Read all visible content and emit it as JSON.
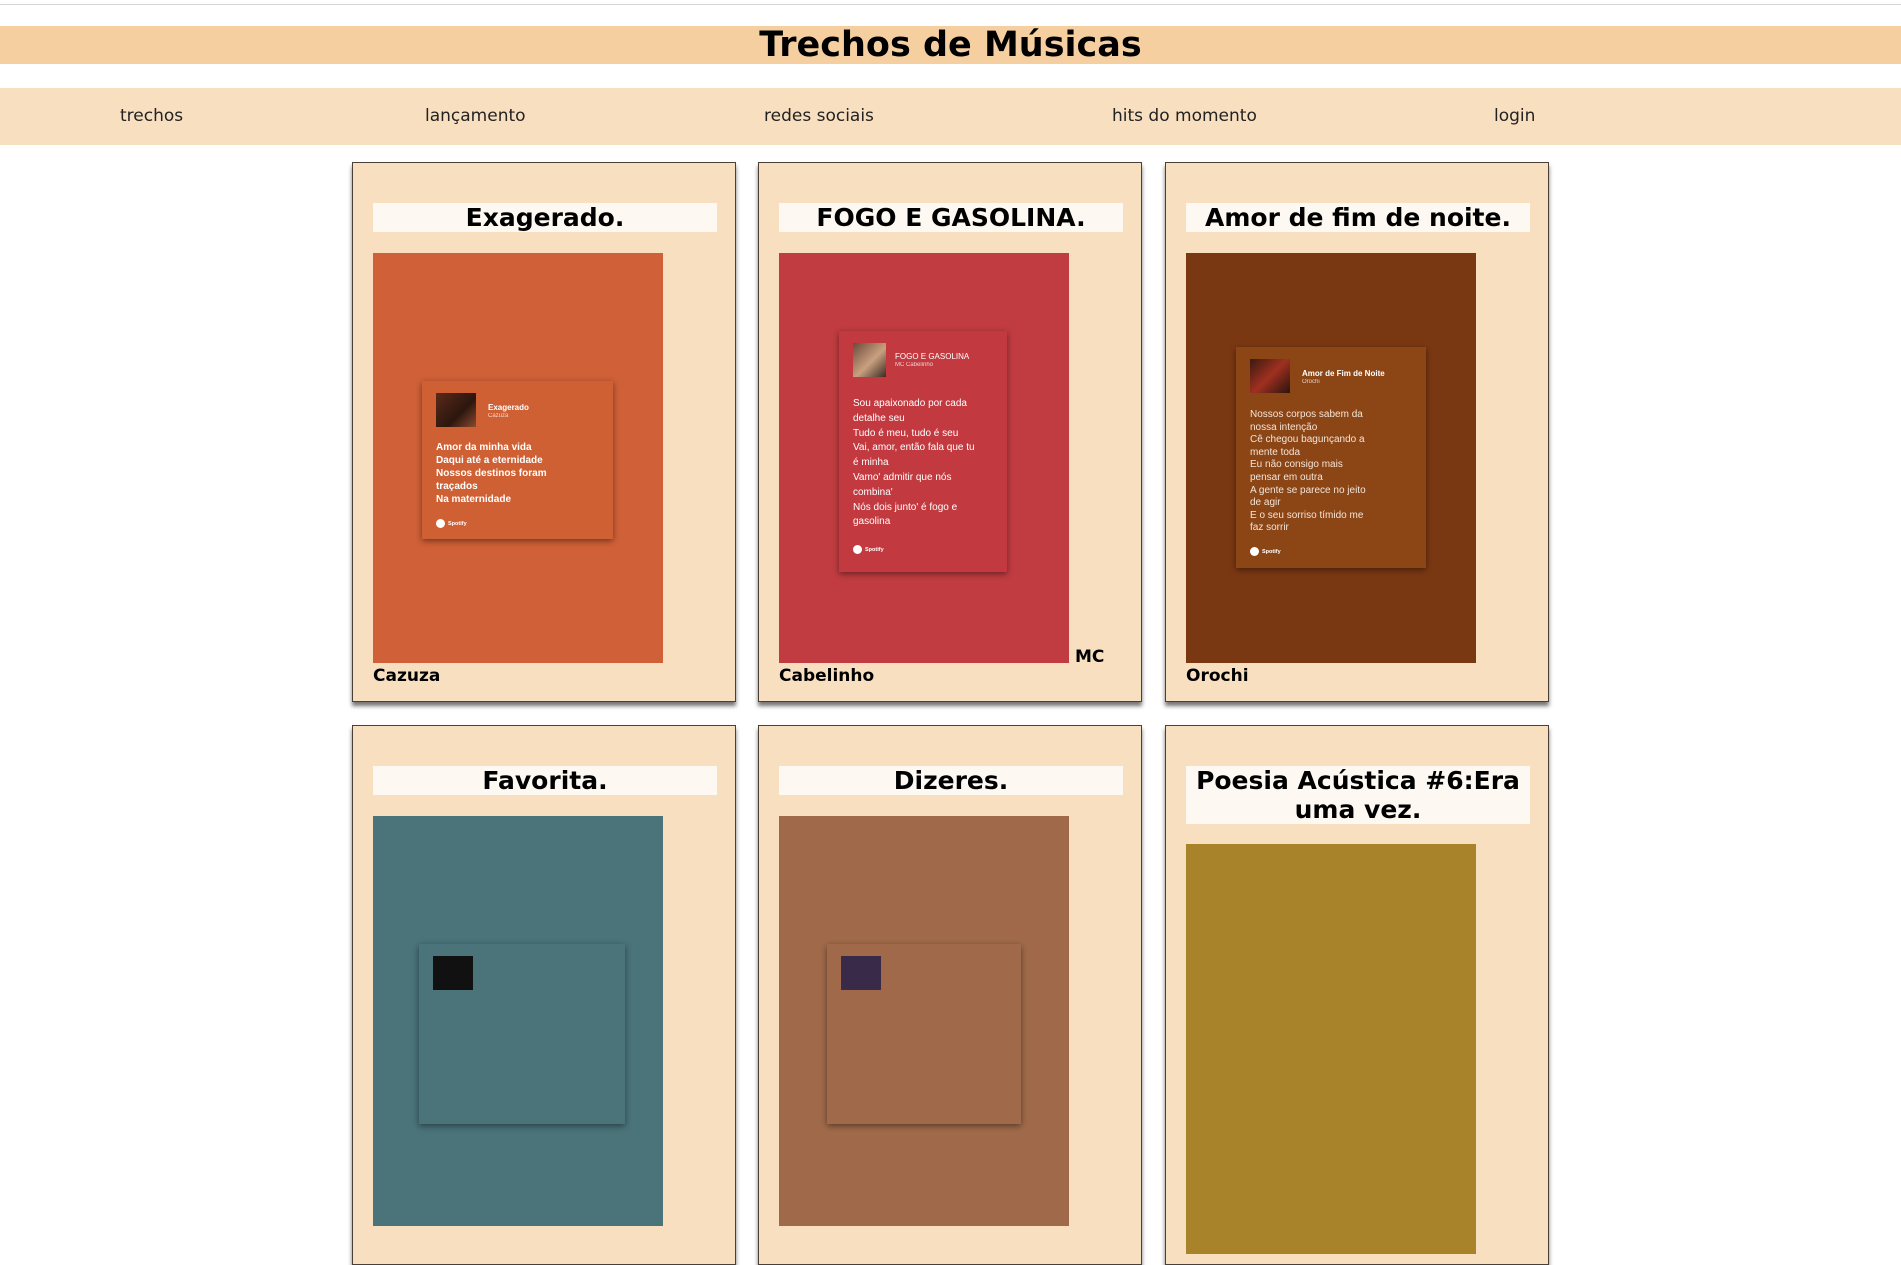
{
  "header": {
    "title": "Trechos de Músicas"
  },
  "nav": {
    "items": [
      {
        "label": "trechos"
      },
      {
        "label": "lançamento"
      },
      {
        "label": "redes sociais"
      },
      {
        "label": "hits do momento"
      },
      {
        "label": "login"
      }
    ]
  },
  "cards": [
    {
      "title": "Exagerado.",
      "artist": "Cazuza",
      "cover_color": "#d06038",
      "lyric_card": {
        "song": "Exagerado",
        "artist": "Cazuza",
        "lines": [
          "Amor da minha vida",
          "Daqui até a eternidade",
          "Nossos destinos foram",
          "traçados",
          "Na maternidade"
        ],
        "brand": "Spotify"
      }
    },
    {
      "title": "FOGO E GASOLINA.",
      "artist_prefix": "MC",
      "artist": "Cabelinho",
      "cover_color": "#c13c40",
      "lyric_card": {
        "song": "FOGO E GASOLINA",
        "artist": "MC Cabelinho",
        "lines": [
          "Sou apaixonado por cada",
          "detalhe seu",
          "Tudo é meu, tudo é seu",
          "Vai, amor, então fala que tu",
          "é minha",
          "Vamo' admitir que nós",
          "combina'",
          "Nós dois junto' é fogo e",
          "gasolina"
        ],
        "brand": "Spotify"
      }
    },
    {
      "title": "Amor de fim de noite.",
      "artist": "Orochi",
      "cover_color": "#7a3812",
      "lyric_card": {
        "song": "Amor de Fim de Noite",
        "artist": "Orochi",
        "lines": [
          "Nossos corpos sabem da",
          "nossa intenção",
          "Cê chegou bagunçando a",
          "mente toda",
          "Eu não consigo mais",
          "pensar em outra",
          "A gente se parece no jeito",
          "de agir",
          "E o seu sorriso tímido me",
          "faz sorrir"
        ],
        "brand": "Spotify"
      }
    },
    {
      "title": "Favorita.",
      "cover_color": "#4a737a"
    },
    {
      "title": "Dizeres.",
      "cover_color": "#a06a4a"
    },
    {
      "title": "Poesia Acústica #6:Era uma vez.",
      "cover_color": "#a8832a"
    }
  ]
}
